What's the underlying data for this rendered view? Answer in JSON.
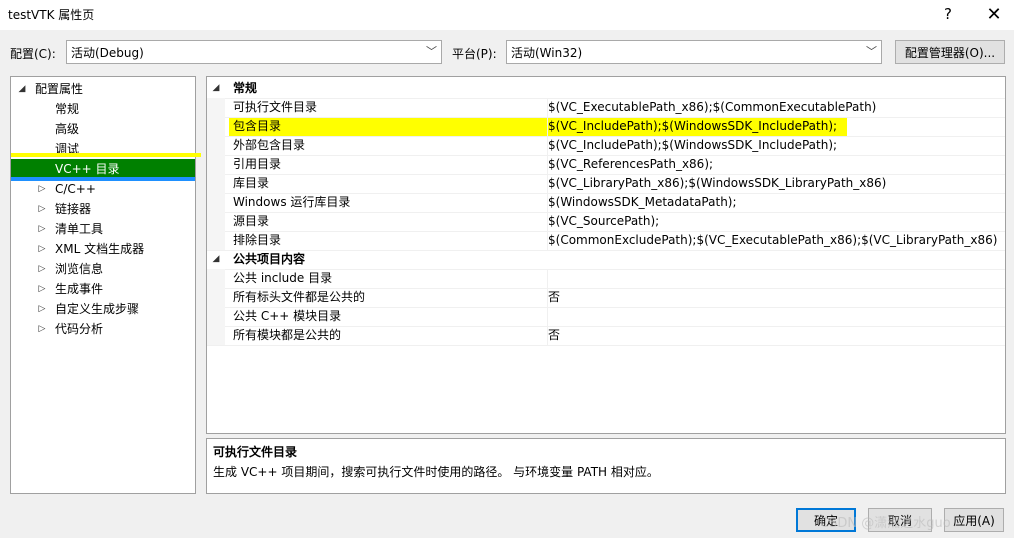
{
  "window": {
    "title": "testVTK 属性页",
    "help_glyph": "?",
    "close_glyph": "✕"
  },
  "config_bar": {
    "config_label": "配置(C):",
    "config_value": "活动(Debug)",
    "platform_label": "平台(P):",
    "platform_value": "活动(Win32)",
    "config_manager_label": "配置管理器(O)..."
  },
  "tree": {
    "root": "配置属性",
    "items": [
      {
        "label": "常规",
        "expandable": false
      },
      {
        "label": "高级",
        "expandable": false
      },
      {
        "label": "调试",
        "expandable": false
      },
      {
        "label": "VC++ 目录",
        "expandable": false,
        "selected": true
      },
      {
        "label": "C/C++",
        "expandable": true
      },
      {
        "label": "链接器",
        "expandable": true
      },
      {
        "label": "清单工具",
        "expandable": true
      },
      {
        "label": "XML 文档生成器",
        "expandable": true
      },
      {
        "label": "浏览信息",
        "expandable": true
      },
      {
        "label": "生成事件",
        "expandable": true
      },
      {
        "label": "自定义生成步骤",
        "expandable": true
      },
      {
        "label": "代码分析",
        "expandable": true
      }
    ],
    "selected_color": "#008000",
    "highlight_color": "#ffff00"
  },
  "grid": {
    "categories": [
      {
        "name": "常规",
        "properties": [
          {
            "name": "可执行文件目录",
            "value": "$(VC_ExecutablePath_x86);$(CommonExecutablePath)"
          },
          {
            "name": "包含目录",
            "value": "$(VC_IncludePath);$(WindowsSDK_IncludePath);"
          },
          {
            "name": "外部包含目录",
            "value": "$(VC_IncludePath);$(WindowsSDK_IncludePath);"
          },
          {
            "name": "引用目录",
            "value": "$(VC_ReferencesPath_x86);"
          },
          {
            "name": "库目录",
            "value": "$(VC_LibraryPath_x86);$(WindowsSDK_LibraryPath_x86)"
          },
          {
            "name": "Windows 运行库目录",
            "value": "$(WindowsSDK_MetadataPath);"
          },
          {
            "name": "源目录",
            "value": "$(VC_SourcePath);"
          },
          {
            "name": "排除目录",
            "value": "$(CommonExcludePath);$(VC_ExecutablePath_x86);$(VC_LibraryPath_x86)"
          }
        ]
      },
      {
        "name": "公共项目内容",
        "properties": [
          {
            "name": "公共 include 目录",
            "value": ""
          },
          {
            "name": "所有标头文件都是公共的",
            "value": "否"
          },
          {
            "name": "公共 C++ 模块目录",
            "value": ""
          },
          {
            "name": "所有模块都是公共的",
            "value": "否"
          }
        ]
      }
    ]
  },
  "description": {
    "title": "可执行文件目录",
    "text": "生成 VC++ 项目期间，搜索可执行文件时使用的路径。 与环境变量 PATH 相对应。"
  },
  "buttons": {
    "ok": "确定",
    "cancel": "取消",
    "apply": "应用(A)"
  },
  "watermark": "CSDN @潇湘之水guo"
}
